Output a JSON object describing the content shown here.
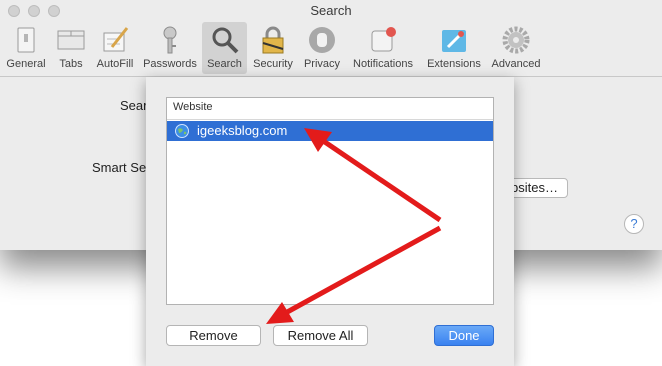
{
  "window": {
    "title": "Search"
  },
  "toolbar": {
    "items": [
      {
        "label": "General",
        "icon": "general-icon"
      },
      {
        "label": "Tabs",
        "icon": "tabs-icon"
      },
      {
        "label": "AutoFill",
        "icon": "autofill-icon"
      },
      {
        "label": "Passwords",
        "icon": "key-icon"
      },
      {
        "label": "Search",
        "icon": "magnifier-icon",
        "selected": true
      },
      {
        "label": "Security",
        "icon": "lock-icon"
      },
      {
        "label": "Privacy",
        "icon": "hand-icon"
      },
      {
        "label": "Notifications",
        "icon": "notification-icon"
      },
      {
        "label": "Extensions",
        "icon": "extensions-icon"
      },
      {
        "label": "Advanced",
        "icon": "gear-icon"
      }
    ]
  },
  "pane": {
    "search_label": "Sear",
    "smart_search_label": "Smart Se",
    "websites_button": "bsites…",
    "help": "?"
  },
  "sheet": {
    "column_header": "Website",
    "rows": [
      {
        "site": "igeeksblog.com",
        "icon": "globe-icon",
        "selected": true
      }
    ],
    "remove": "Remove",
    "remove_all": "Remove All",
    "done": "Done"
  },
  "colors": {
    "selection": "#2f6fd4",
    "arrow": "#e31b1b",
    "accent": "#3a82f0"
  }
}
